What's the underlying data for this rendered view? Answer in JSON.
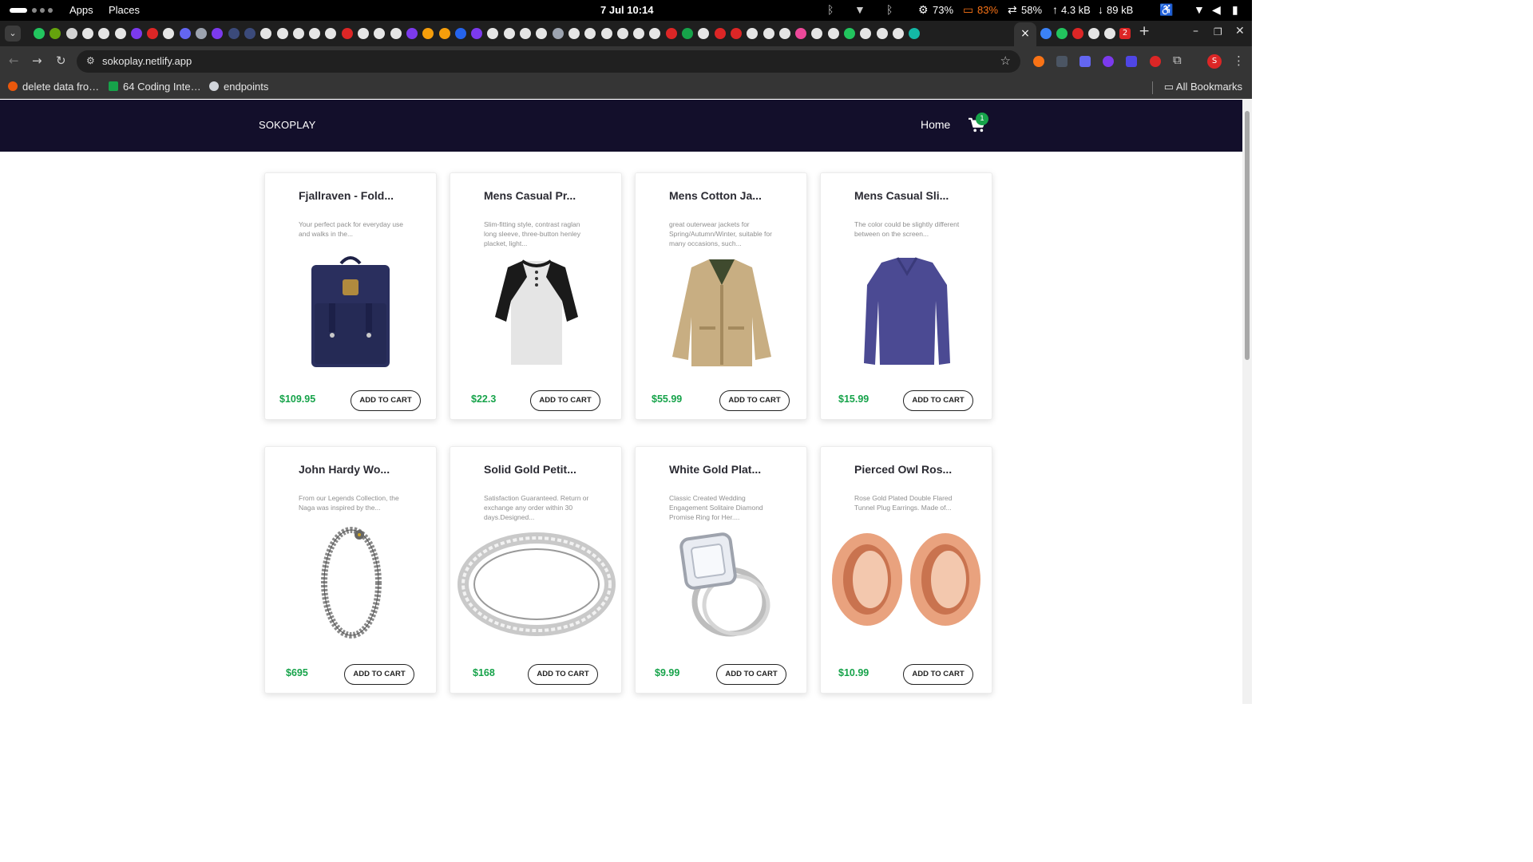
{
  "os": {
    "apps_label": "Apps",
    "places_label": "Places",
    "clock": "7 Jul  10:14",
    "cpu": "73%",
    "battery": "83%",
    "memory": "58%",
    "upload": "4.3 kB",
    "download": "89 kB"
  },
  "browser": {
    "url": "sokoplay.netlify.app",
    "active_tab_close": "×",
    "new_tab": "+",
    "bookmarks": [
      "delete data fro…",
      "64 Coding Inte…",
      "endpoints"
    ],
    "all_bookmarks_label": "All Bookmarks",
    "profile_initial": "S",
    "tab_badge": "2"
  },
  "site": {
    "brand": "SOKOPLAY",
    "home_link": "Home",
    "cart_count": "1",
    "add_to_cart_label": "ADD TO CART"
  },
  "products": [
    {
      "title": "Fjallraven - Fold...",
      "desc": "Your perfect pack for everyday use and walks in the...",
      "price": "$109.95",
      "image": "navy-backpack"
    },
    {
      "title": "Mens Casual Pr...",
      "desc": "Slim-fitting style, contrast raglan long sleeve, three-button henley placket, light...",
      "price": "$22.3",
      "image": "raglan-henley-shirt"
    },
    {
      "title": "Mens Cotton Ja...",
      "desc": "great outerwear jackets for Spring/Autumn/Winter, suitable for many occasions, such...",
      "price": "$55.99",
      "image": "khaki-cotton-jacket"
    },
    {
      "title": "Mens Casual Sli...",
      "desc": "The color could be slightly different between on the screen...",
      "price": "$15.99",
      "image": "purple-long-sleeve-tee"
    },
    {
      "title": "John Hardy Wo...",
      "desc": "From our Legends Collection, the Naga was inspired by the...",
      "price": "$695",
      "image": "dragon-chain-bracelet"
    },
    {
      "title": "Solid Gold Petit...",
      "desc": "Satisfaction Guaranteed. Return or exchange any order within 30 days.Designed...",
      "price": "$168",
      "image": "diamond-band-ring"
    },
    {
      "title": "White Gold Plat...",
      "desc": "Classic Created Wedding Engagement Solitaire Diamond Promise Ring for Her....",
      "price": "$9.99",
      "image": "halo-engagement-ring"
    },
    {
      "title": "Pierced Owl Ros...",
      "desc": "Rose Gold Plated Double Flared Tunnel Plug Earrings. Made of...",
      "price": "$10.99",
      "image": "rose-gold-tunnel-plugs"
    }
  ],
  "colors": {
    "navbar": "#130f2b",
    "price_green": "#16a34a",
    "badge_green": "#16a34a"
  }
}
